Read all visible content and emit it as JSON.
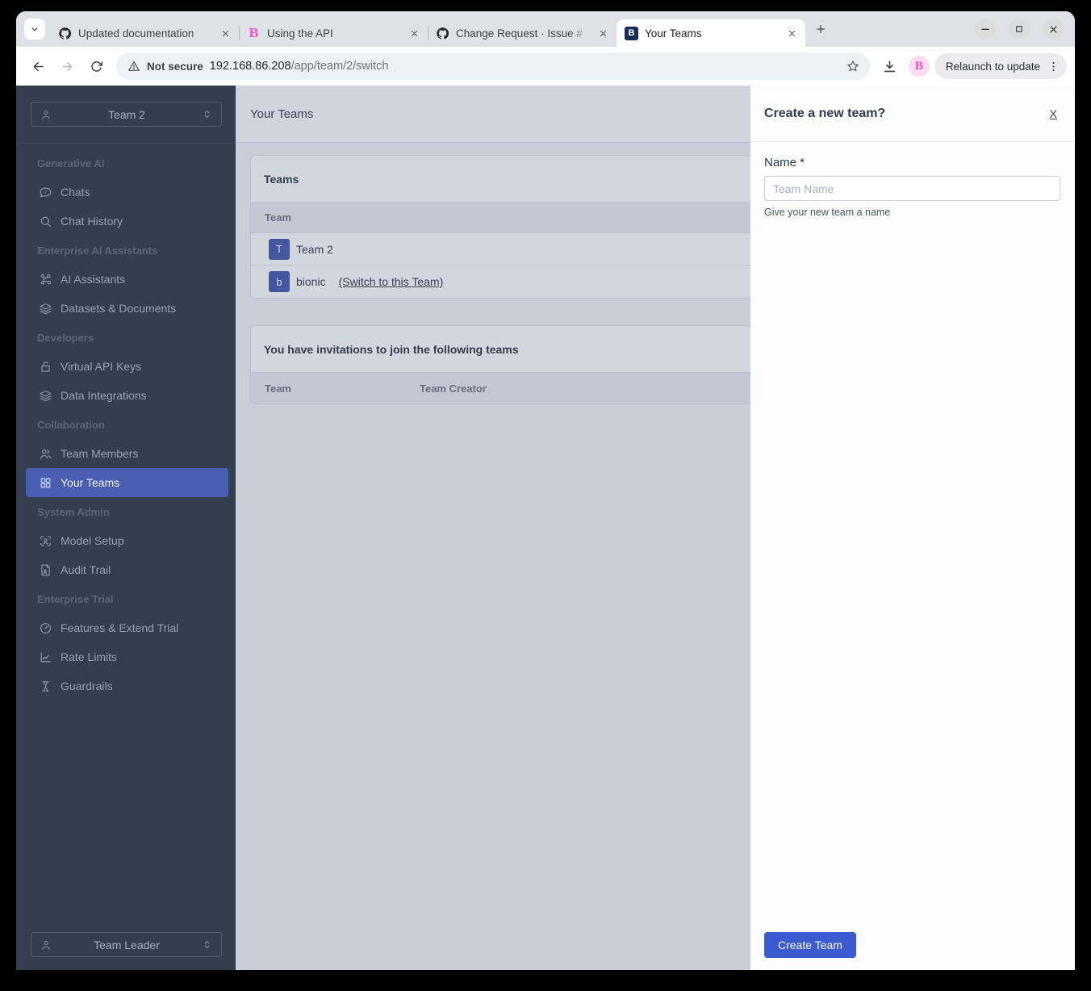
{
  "browser": {
    "tabs": [
      {
        "label": "Updated documentation",
        "favicon": "github-icon"
      },
      {
        "label": "Using the API",
        "favicon": "bionic-pink-b-icon",
        "favicon_text": "B"
      },
      {
        "label": "Change Request · Issue #",
        "favicon": "github-icon"
      },
      {
        "label": "Your Teams",
        "favicon": "navy-b-icon",
        "favicon_text": "B",
        "active": true
      }
    ],
    "toolbar": {
      "security_label": "Not secure",
      "url_host": "192.168.86.208",
      "url_path": "/app/team/2/switch",
      "extension_letter": "B",
      "relaunch_label": "Relaunch to update"
    }
  },
  "sidebar": {
    "team_selector": "Team 2",
    "role_selector": "Team Leader",
    "sections": [
      {
        "label": "Generative AI",
        "items": [
          {
            "label": "Chats",
            "icon": "chat-question-icon"
          },
          {
            "label": "Chat History",
            "icon": "search-icon"
          }
        ]
      },
      {
        "label": "Enterprise AI Assistants",
        "items": [
          {
            "label": "AI Assistants",
            "icon": "command-icon"
          },
          {
            "label": "Datasets & Documents",
            "icon": "layers-icon"
          }
        ]
      },
      {
        "label": "Developers",
        "items": [
          {
            "label": "Virtual API Keys",
            "icon": "unlock-icon"
          },
          {
            "label": "Data Integrations",
            "icon": "layers-icon"
          }
        ]
      },
      {
        "label": "Collaboration",
        "items": [
          {
            "label": "Team Members",
            "icon": "users-icon"
          },
          {
            "label": "Your Teams",
            "icon": "grid-icon",
            "active": true
          }
        ]
      },
      {
        "label": "System Admin",
        "items": [
          {
            "label": "Model Setup",
            "icon": "user-scan-icon"
          },
          {
            "label": "Audit Trail",
            "icon": "document-icon"
          }
        ]
      },
      {
        "label": "Enterprise Trial",
        "items": [
          {
            "label": "Features & Extend Trial",
            "icon": "gauge-icon"
          },
          {
            "label": "Rate Limits",
            "icon": "chart-line-icon"
          },
          {
            "label": "Guardrails",
            "icon": "guardrails-icon"
          }
        ]
      }
    ]
  },
  "main": {
    "page_title": "Your Teams",
    "teams_card": {
      "title": "Teams",
      "columns": [
        "Team"
      ],
      "rows": [
        {
          "avatar": "T",
          "name": "Team 2",
          "link": ""
        },
        {
          "avatar": "b",
          "name": "bionic",
          "link": "(Switch to this Team)"
        }
      ]
    },
    "invitations_card": {
      "title": "You have invitations to join the following teams",
      "columns": [
        "Team",
        "Team Creator"
      ]
    }
  },
  "panel": {
    "title": "Create a new team?",
    "close_label": "X",
    "name_label": "Name *",
    "name_placeholder": "Team Name",
    "name_help": "Give your new team a name",
    "submit_label": "Create Team"
  },
  "colors": {
    "accent_button": "#3c5bd0",
    "sidebar_bg": "#343e4e",
    "active_nav_item": "#4a5fb2",
    "team_avatar": "#44569f",
    "main_overlay_bg": "#c9ced7",
    "panel_bg": "#fbfcfb"
  }
}
